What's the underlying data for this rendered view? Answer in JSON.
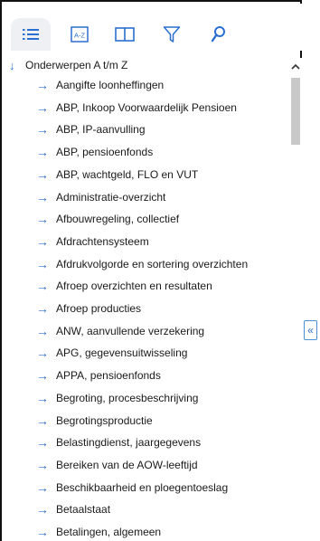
{
  "tabs": [
    {
      "name": "list-icon",
      "active": true
    },
    {
      "name": "a-z-icon",
      "text": "A-Z"
    },
    {
      "name": "book-icon"
    },
    {
      "name": "filter-icon"
    },
    {
      "name": "search-icon"
    }
  ],
  "tree": {
    "root_label": "Onderwerpen A t/m Z",
    "items": [
      "Aangifte loonheffingen",
      "ABP, Inkoop Voorwaardelijk Pensioen",
      "ABP, IP-aanvulling",
      "ABP, pensioenfonds",
      "ABP, wachtgeld, FLO en VUT",
      "Administratie-overzicht",
      "Afbouwregeling, collectief",
      "Afdrachtensysteem",
      "Afdrukvolgorde en sortering overzichten",
      "Afroep overzichten en resultaten",
      "Afroep producties",
      "ANW, aanvullende verzekering",
      "APG, gegevensuitwisseling",
      "APPA, pensioenfonds",
      "Begroting, procesbeschrijving",
      "Begrotingsproductie",
      "Belastingdienst, jaargegevens",
      "Bereiken van de AOW-leeftijd",
      "Beschikbaarheid en ploegentoeslag",
      "Betaalstaat",
      "Betalingen, algemeen"
    ]
  },
  "collapse_button": {
    "label": "«"
  },
  "colors": {
    "accent": "#2a6fd0",
    "tab_active_bg": "#eef0f4"
  }
}
